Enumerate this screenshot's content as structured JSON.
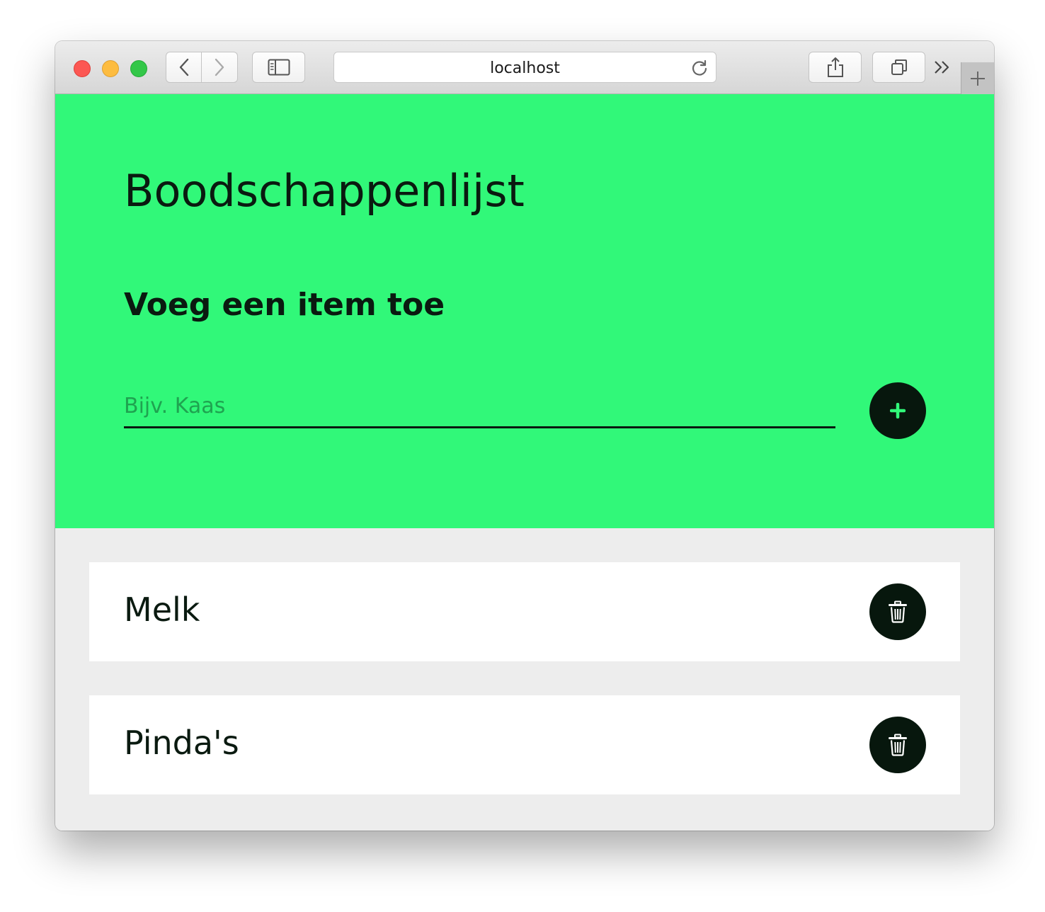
{
  "browser": {
    "address": "localhost",
    "icons": {
      "back": "chevron-left-icon",
      "forward": "chevron-right-icon",
      "sidebar": "sidebar-icon",
      "reload": "reload-icon",
      "share": "share-icon",
      "tabs": "tabs-icon",
      "overflow": "chevron-double-right-icon",
      "new_tab": "plus-icon"
    }
  },
  "app": {
    "title": "Boodschappenlijst",
    "add_section": {
      "heading": "Voeg een item toe",
      "placeholder": "Bijv. Kaas",
      "value": "",
      "add_icon": "plus-icon"
    },
    "items": [
      {
        "label": "Melk",
        "delete_icon": "trash-icon"
      },
      {
        "label": "Pinda's",
        "delete_icon": "trash-icon"
      }
    ]
  },
  "colors": {
    "hero_background": "#31f879",
    "page_background": "#ededed",
    "button_background": "#07170d",
    "plus_icon": "#31f879",
    "trash_icon": "#ffffff",
    "text": "#0a1a10"
  }
}
